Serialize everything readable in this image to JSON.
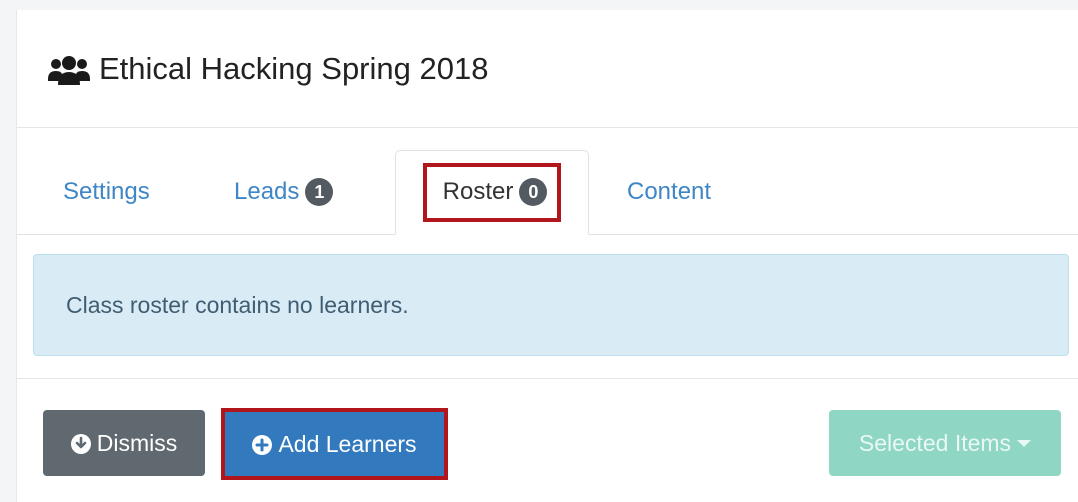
{
  "header": {
    "title": "Ethical Hacking Spring 2018",
    "icon": "users-icon"
  },
  "tabs": [
    {
      "label": "Settings"
    },
    {
      "label": "Leads",
      "badge": "1"
    },
    {
      "label": "Roster",
      "badge": "0",
      "active": true
    },
    {
      "label": "Content"
    }
  ],
  "alert": {
    "text": "Class roster contains no learners."
  },
  "actions": {
    "dismiss_label": "Dismiss",
    "add_label": "Add Learners",
    "selected_label": "Selected Items"
  },
  "colors": {
    "link": "#3f86c6",
    "highlight": "#b1161d",
    "primary": "#3279be",
    "secondary": "#606970",
    "success_disabled": "#8fd6c5",
    "alert_bg": "#d9ecf6"
  }
}
